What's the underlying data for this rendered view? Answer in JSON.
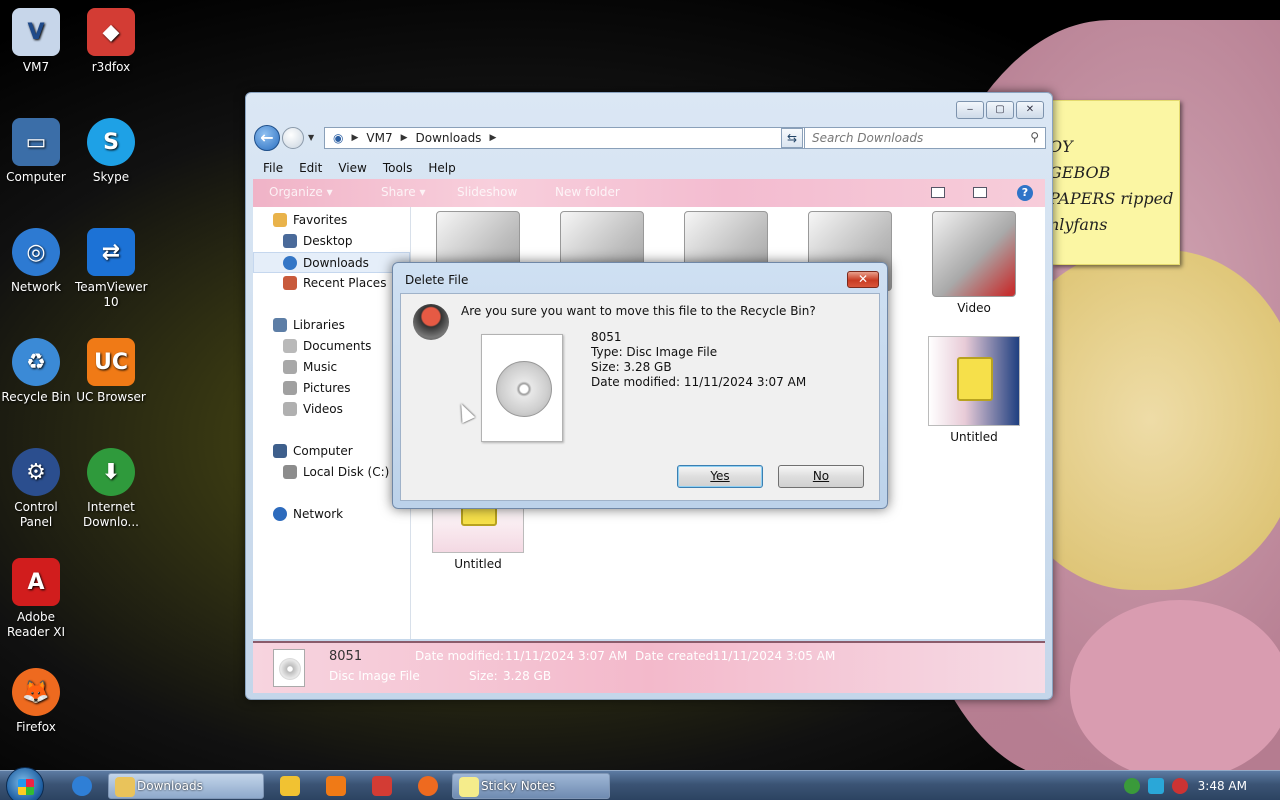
{
  "desktop_icons": [
    {
      "label": "VM7",
      "icon": "vm7-icon",
      "color": "#c7d6ea"
    },
    {
      "label": "r3dfox",
      "icon": "r3dfox-icon",
      "color": "#d33c34"
    },
    {
      "label": "Computer",
      "icon": "computer-icon",
      "color": "#3b6ea8"
    },
    {
      "label": "Skype",
      "icon": "skype-icon",
      "color": "#1ea1e6"
    },
    {
      "label": "Network",
      "icon": "network-icon",
      "color": "#2d7ad2"
    },
    {
      "label": "TeamViewer 10",
      "icon": "teamviewer-icon",
      "color": "#1c72d6"
    },
    {
      "label": "Recycle Bin",
      "icon": "recycle-bin-icon",
      "color": "#3b8ad6"
    },
    {
      "label": "UC Browser",
      "icon": "uc-browser-icon",
      "color": "#f07a16"
    },
    {
      "label": "Control Panel",
      "icon": "control-panel-icon",
      "color": "#2b4e8e"
    },
    {
      "label": "Internet Downlo...",
      "icon": "internet-download-manager-icon",
      "color": "#2f9a3c"
    },
    {
      "label": "Adobe Reader XI",
      "icon": "adobe-reader-icon",
      "color": "#d11d1d"
    },
    {
      "label": "Firefox",
      "icon": "firefox-icon",
      "color": "#ee6a1f"
    }
  ],
  "sticky_note": {
    "lines": [
      "OY",
      "GEBOB",
      "PAPERS ripped",
      "nlyfans"
    ]
  },
  "explorer": {
    "window_controls": {
      "minimize": "‒",
      "maximize": "▢",
      "close": "✕"
    },
    "address": {
      "segments": [
        "VM7",
        "Downloads"
      ]
    },
    "search_placeholder": "Search Downloads",
    "menu": [
      "File",
      "Edit",
      "View",
      "Tools",
      "Help"
    ],
    "command_bar": [
      "Organize ▾",
      "Share ▾",
      "Slideshow",
      "New folder"
    ],
    "nav": {
      "favorites_header": "Favorites",
      "favorites": [
        "Desktop",
        "Downloads",
        "Recent Places"
      ],
      "libraries_header": "Libraries",
      "libraries": [
        "Documents",
        "Music",
        "Pictures",
        "Videos"
      ],
      "computer_header": "Computer",
      "computer_items": [
        "Local Disk (C:)"
      ],
      "network_header": "Network"
    },
    "tiles": {
      "video_label": "Video",
      "untitled_a": "Untitled",
      "untitled_b": "Untitled"
    },
    "details": {
      "name": "8051",
      "type": "Disc Image File",
      "date_modified_label": "Date modified:",
      "date_modified": "11/11/2024 3:07 AM",
      "date_created_label": "Date created:",
      "date_created": "11/11/2024 3:05 AM",
      "size_label": "Size:",
      "size": "3.28 GB"
    }
  },
  "dialog": {
    "title": "Delete File",
    "close": "✕",
    "question": "Are you sure you want to move this file to the Recycle Bin?",
    "file_name": "8051",
    "file_type": "Type: Disc Image File",
    "file_size": "Size: 3.28 GB",
    "file_modified": "Date modified: 11/11/2024 3:07 AM",
    "yes": "Yes",
    "no": "No"
  },
  "taskbar": {
    "items": [
      {
        "label": "Downloads",
        "icon": "folder-icon"
      },
      {
        "label": "Sticky Notes",
        "icon": "sticky-notes-icon"
      }
    ],
    "clock": "3:48 AM"
  }
}
